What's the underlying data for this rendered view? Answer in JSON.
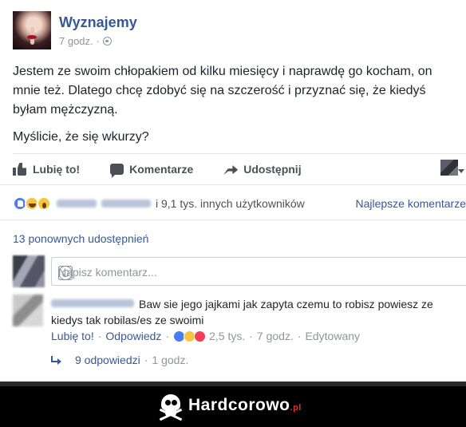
{
  "post": {
    "page_name": "Wyznajemy",
    "time": "7 godz.",
    "separator": "·",
    "icon": "globe-icon",
    "paragraph1": "Jestem ze swoim chłopakiem od kilku miesięcy i naprawdę go kocham, on mnie też. Dlatego chcę zdobyć się na szczerość i przyznać się, że kiedyś byłam mężczyzną.",
    "paragraph2": "Myślicie, że się wkurzy?"
  },
  "actions": {
    "like": "Lubię to!",
    "comment": "Komentarze",
    "share": "Udostępnij"
  },
  "reactions": {
    "icons": [
      "like",
      "haha",
      "wow"
    ],
    "others": "i 9,1 tys. innych użytkowników",
    "top_comments": "Najlepsze komentarze"
  },
  "shares": "13 ponownych udostępnień",
  "compose": {
    "placeholder": "Napisz komentarz..."
  },
  "comment": {
    "text": "Baw sie jego jajkami jak zapyta czemu to robisz powiesz ze kiedys tak robilas/es ze swoimi",
    "like": "Lubię to!",
    "reply": "Odpowiedz",
    "reaction_count": "2,5 tys.",
    "time": "7 godz.",
    "edited": "Edytowany",
    "sep": "·"
  },
  "replies": {
    "label": "9 odpowiedzi",
    "time": "1 godz."
  },
  "banner": {
    "brand": "Hardcorowo",
    "tld": ".pl"
  },
  "colors": {
    "link": "#365899",
    "text": "#1d2129",
    "muted": "#90949c"
  }
}
